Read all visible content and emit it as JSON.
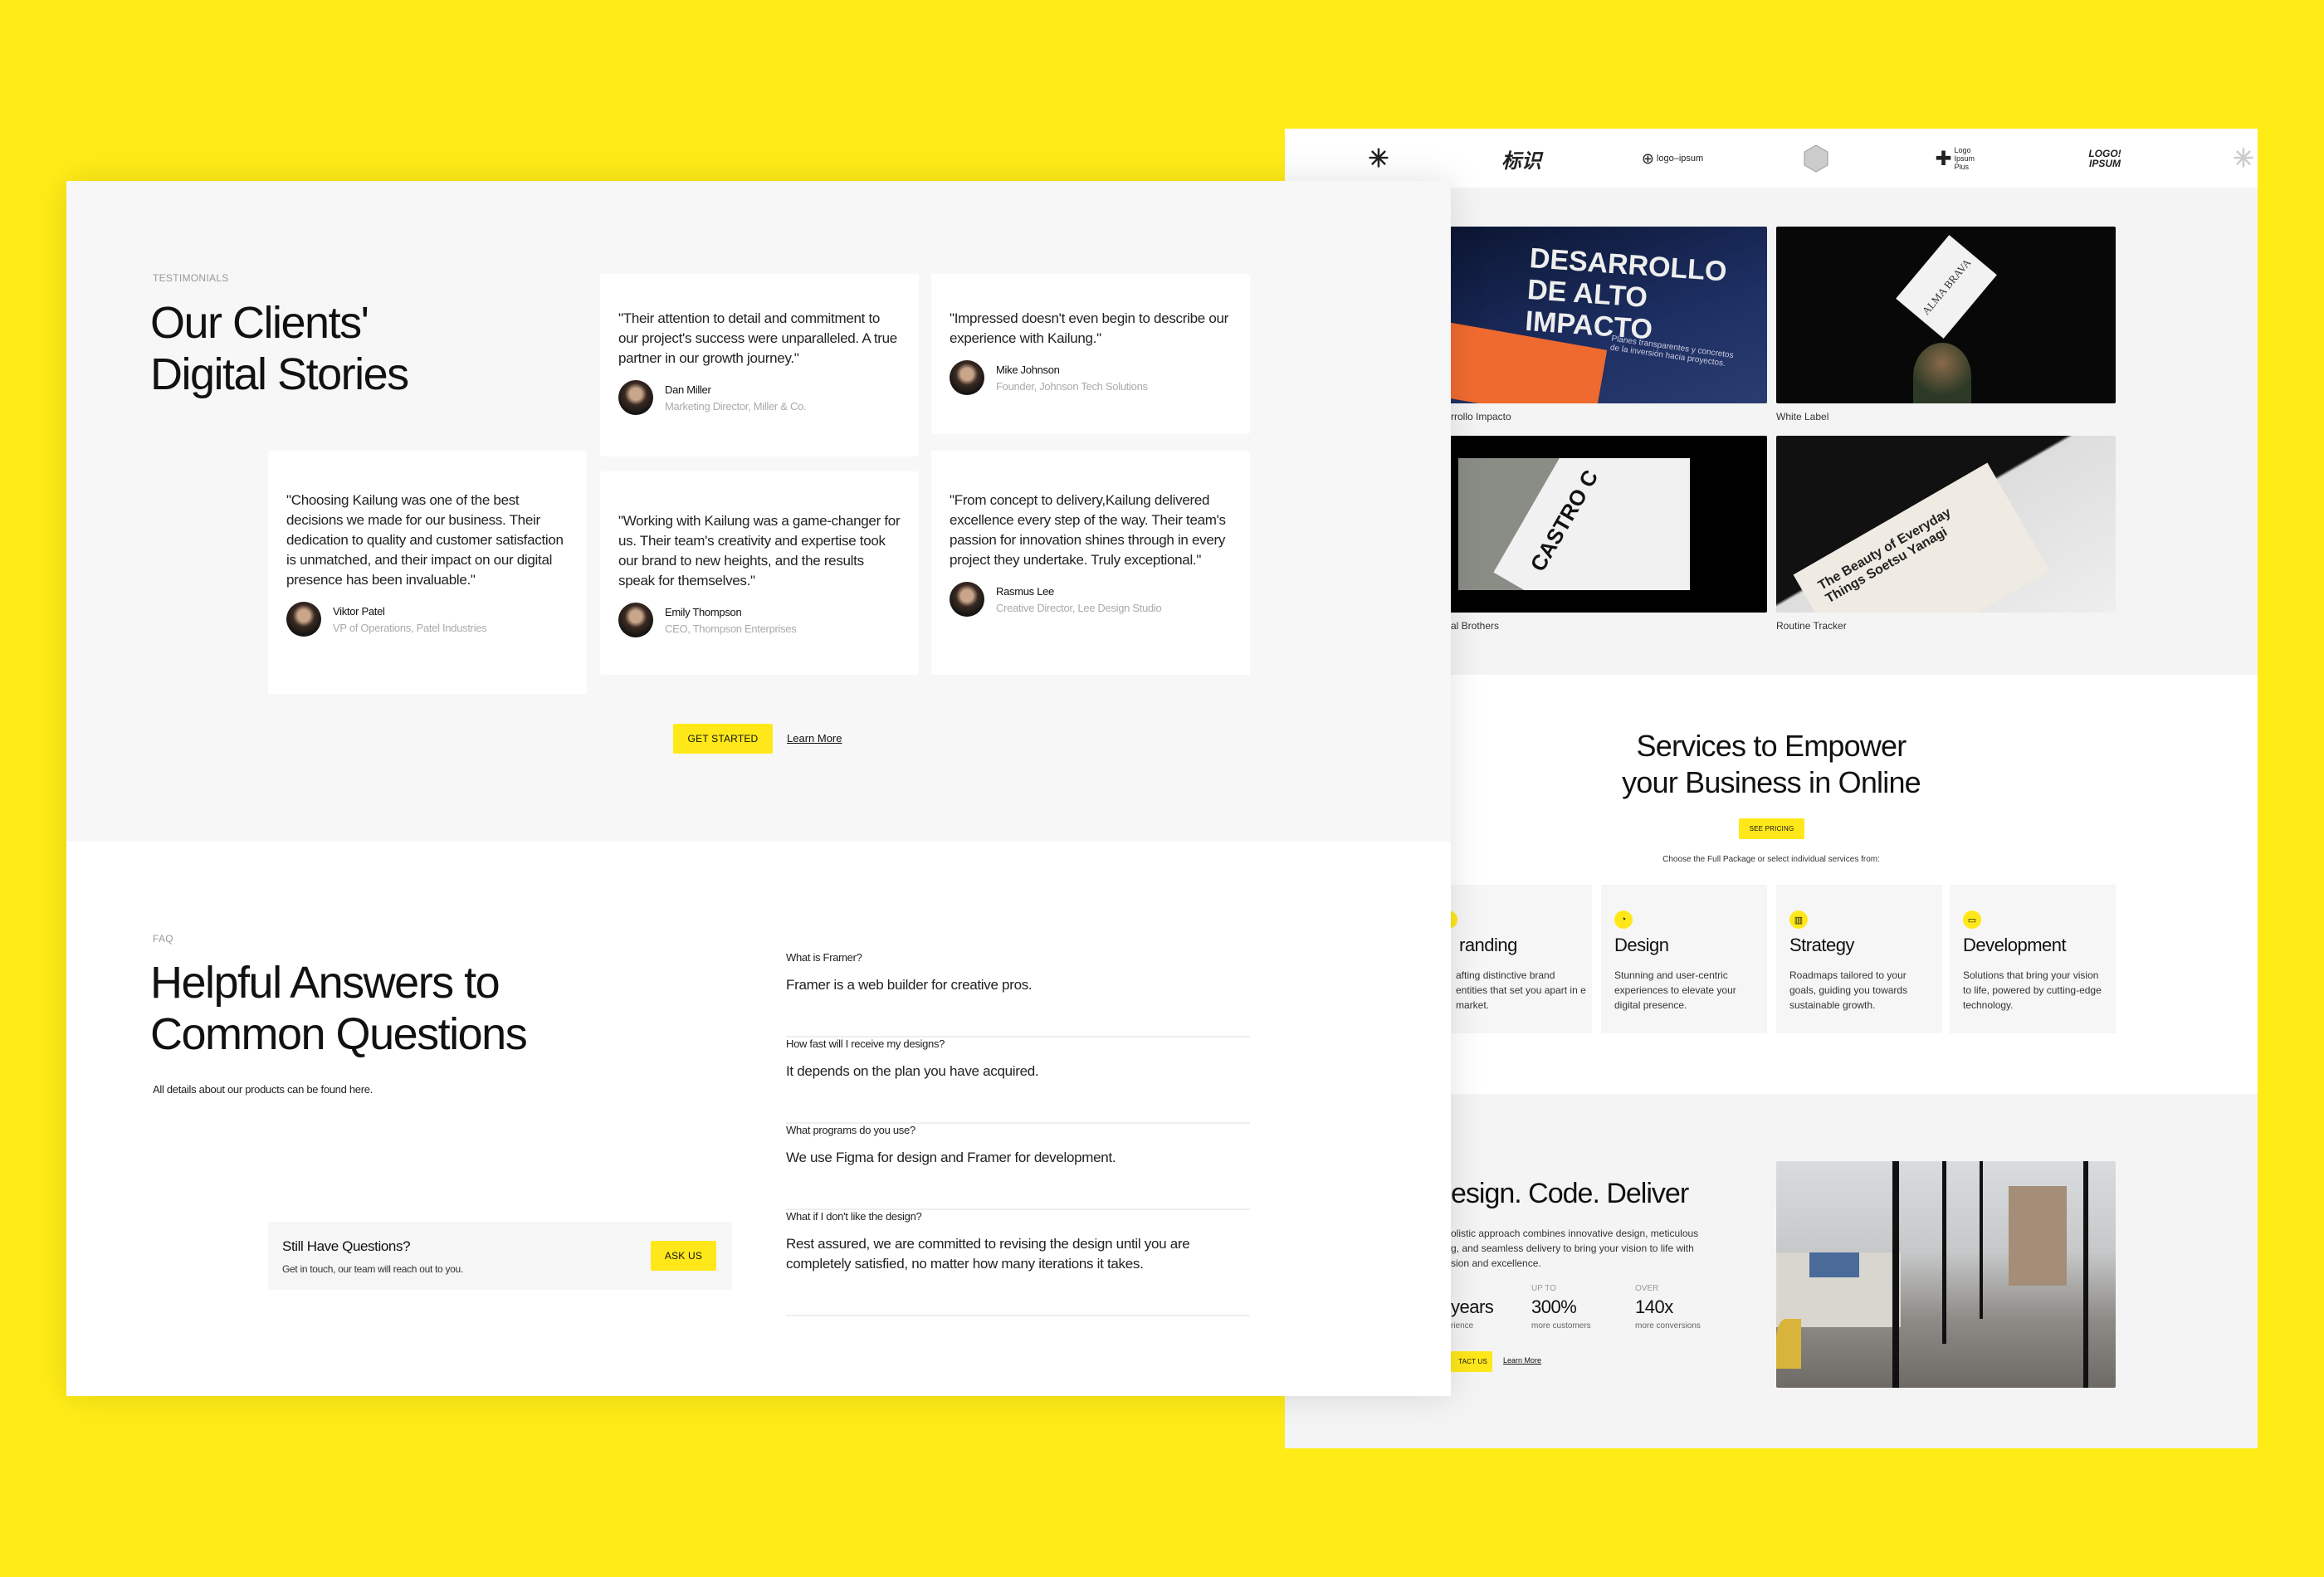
{
  "colors": {
    "background": "#FFEC17",
    "accent": "#FFE81A",
    "panel": "#f7f7f7"
  },
  "testimonials": {
    "label": "TESTIMONIALS",
    "title_line1": "Our Clients'",
    "title_line2": "Digital Stories",
    "cards": [
      {
        "quote": "\"Their attention to detail and commitment to our project's success were unparalleled. A true partner in our growth journey.\"",
        "name": "Dan Miller",
        "role": "Marketing Director, Miller & Co."
      },
      {
        "quote": "\"Impressed doesn't even begin to describe our experience with Kailung.\"",
        "name": "Mike Johnson",
        "role": "Founder, Johnson Tech Solutions"
      },
      {
        "quote": "\"Choosing Kailung was one of the best decisions we made for our business. Their dedication to quality and customer satisfaction is unmatched, and their impact on our digital presence has been invaluable.\"",
        "name": "Viktor Patel",
        "role": "VP of Operations, Patel Industries"
      },
      {
        "quote": "\"Working with Kailung was a game-changer for us. Their team's creativity and expertise took our brand to new heights, and the results speak for themselves.\"",
        "name": "Emily Thompson",
        "role": "CEO, Thompson Enterprises"
      },
      {
        "quote": "\"From concept to delivery,Kailung delivered excellence every step of the way. Their team's passion for innovation shines through in every project they undertake. Truly exceptional.\"",
        "name": "Rasmus Lee",
        "role": "Creative Director, Lee Design Studio"
      }
    ],
    "cta": "GET STARTED",
    "learn_more": "Learn More"
  },
  "faq": {
    "label": "FAQ",
    "title_line1": "Helpful Answers to",
    "title_line2": "Common Questions",
    "subtitle": "All details about our products can be found here.",
    "still_title": "Still Have Questions?",
    "still_sub": "Get in touch, our team will reach out to you.",
    "ask_button": "ASK US",
    "items": [
      {
        "q": "What is Framer?",
        "a": "Framer is a web builder for creative pros."
      },
      {
        "q": "How fast will I receive my designs?",
        "a": "It depends on the plan you have acquired."
      },
      {
        "q": "What programs do you use?",
        "a": "We use Figma for design and Framer for development."
      },
      {
        "q": "What if I don't like the design?",
        "a": "Rest assured, we are committed to revising the design until you are completely satisfied, no matter how many iterations it takes."
      }
    ]
  },
  "right": {
    "logos": [
      "starburst-logo",
      "标识",
      "logo-ipsum",
      "hexagon-logo",
      "Logo Ipsum Plus",
      "LOGO! IPSUM",
      "starburst-logo"
    ],
    "logo_text": {
      "chinese": "标识",
      "ipsum": "logo–ipsum",
      "plus": "Logo Ipsum Plus",
      "bold": "LOGO! IPSUM"
    },
    "projects": [
      {
        "caption": "rrollo Impacto",
        "photo_text": "DESARROLLO DE ALTO IMPACTO",
        "photo_sub": "Planes transparentes y concretos de la inversión hacia proyectos."
      },
      {
        "caption": "White Label",
        "photo_text": "ALMA BRAVA"
      },
      {
        "caption": "al Brothers",
        "photo_text": "CASTRO C"
      },
      {
        "caption": "Routine Tracker",
        "photo_text": "The Beauty of Everyday Things Soetsu Yanagi"
      }
    ],
    "services": {
      "title_line1": "Services to Empower",
      "title_line2": "your Business in Online",
      "button": "SEE PRICING",
      "subtitle": "Choose the Full Package or select individual services from:",
      "cards": [
        {
          "icon": "book-icon",
          "title": "randing",
          "desc": "afting distinctive brand entities that set you apart in e market."
        },
        {
          "icon": "palette-icon",
          "title": "Design",
          "desc": "Stunning and user-centric experiences to elevate your digital presence."
        },
        {
          "icon": "map-icon",
          "title": "Strategy",
          "desc": "Roadmaps tailored to your goals, guiding you towards sustainable growth."
        },
        {
          "icon": "tablet-icon",
          "title": "Development",
          "desc": "Solutions that bring your vision to life, powered by cutting-edge technology."
        }
      ]
    },
    "deliver": {
      "title": "esign. Code. Deliver",
      "paragraph_lines": [
        "olistic approach combines innovative design, meticulous",
        "g, and seamless delivery to bring your vision to life with",
        "sion and excellence."
      ],
      "stats": [
        {
          "label": "",
          "value": "years",
          "sub": "rience"
        },
        {
          "label": "UP TO",
          "value": "300%",
          "sub": "more customers"
        },
        {
          "label": "OVER",
          "value": "140x",
          "sub": "more conversions"
        }
      ],
      "contact": "TACT US",
      "learn_more": "Learn More"
    }
  }
}
